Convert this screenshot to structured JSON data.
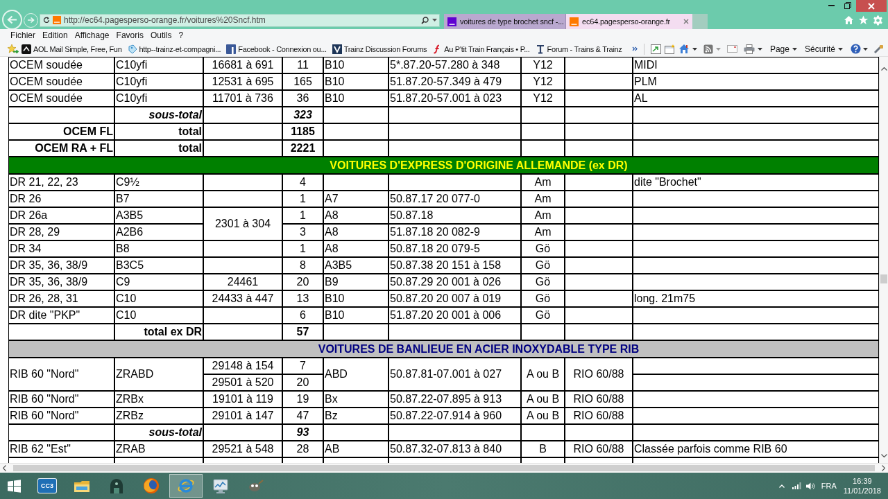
{
  "browser": {
    "address": "http://ec64.pagesperso-orange.fr/voitures%20Sncf.htm",
    "tabs": [
      {
        "title": "voitures de type brochet sncf -...",
        "color": "#5f01d1",
        "selected": false
      },
      {
        "title": "ec64.pagesperso-orange.fr",
        "color": "#ff7900",
        "selected": true
      }
    ]
  },
  "menu_bar": [
    "Fichier",
    "Edition",
    "Affichage",
    "Favoris",
    "Outils",
    "?"
  ],
  "favorites_bar": [
    {
      "label": "AOL Mail Simple, Free, Fun",
      "kind": "dark_tile"
    },
    {
      "label": "http--trainz-et-compagni...",
      "kind": "tag"
    },
    {
      "label": "Facebook - Connexion ou...",
      "kind": "blue_tile"
    },
    {
      "label": "Trainz Discussion Forums",
      "kind": "navy_tile"
    },
    {
      "label": "Au P'tit Train Français • P...",
      "kind": "red_stroke"
    },
    {
      "label": "Forum - Trains & Trainz",
      "kind": "beam"
    }
  ],
  "command_bar": {
    "menus": [
      "Page",
      "Sécurité"
    ]
  },
  "table": {
    "rows": [
      {
        "kind": "data",
        "column_1": "OCEM soudée",
        "column_2": "C10yfi",
        "column_3": "16681 à 691",
        "column_4": "11",
        "column_5": "B10",
        "column_6": "5*.87.20-57.280 à 348",
        "column_7": "Y12",
        "column_9": "MIDI"
      },
      {
        "kind": "data",
        "column_1": "OCEM soudée",
        "column_2": "C10yfi",
        "column_3": "12531 à 695",
        "column_4": "165",
        "column_5": "B10",
        "column_6": "51.87.20-57.349 à 479",
        "column_7": "Y12",
        "column_9": "PLM"
      },
      {
        "kind": "data",
        "column_1": "OCEM soudée",
        "column_2": "C10yfi",
        "column_3": "11701 à 736",
        "column_4": "36",
        "column_5": "B10",
        "column_6": "51.87.20-57.001 à 023",
        "column_7": "Y12",
        "column_9": "AL"
      },
      {
        "kind": "subtotal",
        "column_2": "sous-total",
        "column_4": "323"
      },
      {
        "kind": "total",
        "column_1": "OCEM FL",
        "column_2": "total",
        "column_4": "1185"
      },
      {
        "kind": "total",
        "column_1": "OCEM RA + FL",
        "column_2": "total",
        "column_4": "2221"
      },
      {
        "kind": "section",
        "color": "#008000",
        "title": {
          "text": "VOITURES D'EXPRESS D'ORIGINE ALLEMANDE (ex DR)",
          "color": "#ffff00"
        }
      },
      {
        "kind": "data",
        "column_1": "DR 21, 22, 23",
        "column_2": "C9½",
        "column_4": "4",
        "column_7": "Am",
        "column_9": "dite \"Brochet\""
      },
      {
        "kind": "data",
        "column_1": "DR 26",
        "column_2": "B7",
        "column_4": "1",
        "column_5": "A7",
        "column_6": "50.87.17 20 077-0",
        "column_7": "Am"
      },
      {
        "kind": "data",
        "column_3": "2301 à 304",
        "lines": [
          {
            "column_1": "DR 26a",
            "column_2": "A3B5",
            "column_4": "1",
            "column_5": "A8",
            "column_6": "50.87.18",
            "column_7": "Am"
          },
          {
            "column_1": "DR 28, 29",
            "column_2": "A2B6",
            "column_4": "3",
            "column_5": "A8",
            "column_6": "51.87.18 20 082-9",
            "column_7": "Am"
          }
        ]
      },
      {
        "kind": "data",
        "column_1": "DR 34",
        "column_2": "B8",
        "column_4": "1",
        "column_5": "A8",
        "column_6": "50.87.18 20 079-5",
        "column_7": "Gö"
      },
      {
        "kind": "data",
        "column_1": "DR 35, 36, 38/9",
        "column_2": "B3C5",
        "column_4": "8",
        "column_5": "A3B5",
        "column_6": "50.87.38 20 151 à 158",
        "column_7": "Gö"
      },
      {
        "kind": "data",
        "column_1": "DR 35, 36, 38/9",
        "column_2": "C9",
        "column_3": "24461",
        "column_4": "20",
        "column_5": "B9",
        "column_6": "50.87.29 20 001 à 026",
        "column_7": "Gö"
      },
      {
        "kind": "data",
        "column_1": "DR 26, 28, 31",
        "column_2": "C10",
        "column_3": "24433 à 447",
        "column_4": "13",
        "column_5": "B10",
        "column_6": "50.87.20 20 007 à 019",
        "column_7": "Gö",
        "column_9": "long. 21m75"
      },
      {
        "kind": "data",
        "column_1": "DR dite \"PKP\"",
        "column_2": "C10",
        "column_4": "6",
        "column_5": "B10",
        "column_6": "51.87.20 20 001 à 006",
        "column_7": "Gö"
      },
      {
        "kind": "total",
        "column_2": "total ex DR",
        "column_4": "57"
      },
      {
        "kind": "section",
        "color": "#c0c0c0",
        "title": {
          "text": "VOITURES DE BANLIEUE EN ACIER INOXYDABLE TYPE RIB",
          "color": "#000080"
        }
      },
      {
        "kind": "data",
        "column_1": "RIB 60 \"Nord\"",
        "column_2": "ZRABD",
        "column_5": "ABD",
        "column_6": "50.87.81-07.001 à 027",
        "column_7": "A ou B",
        "column_8": "RIO 60/88",
        "lines": [
          {
            "column_3": "29148 à 154",
            "column_4": "7"
          },
          {
            "column_3": "29501 à 520",
            "column_4": "20"
          }
        ]
      },
      {
        "kind": "data",
        "column_1": "RIB 60 \"Nord\"",
        "column_2": "ZRBx",
        "column_3": "19101 à 119",
        "column_4": "19",
        "column_5": "Bx",
        "column_6": "50.87.22-07.895 à 913",
        "column_7": "A ou B",
        "column_8": "RIO 60/88"
      },
      {
        "kind": "data",
        "column_1": "RIB 60 \"Nord\"",
        "column_2": "ZRBz",
        "column_3": "29101 à 147",
        "column_4": "47",
        "column_5": "Bz",
        "column_6": "50.87.22-07.914 à 960",
        "column_7": "A ou B",
        "column_8": "RIO 60/88"
      },
      {
        "kind": "subtotal",
        "column_2": "sous-total",
        "column_4": "93"
      },
      {
        "kind": "data",
        "column_1": "RIB 62 \"Est\"",
        "column_2": "ZRAB",
        "column_3": "29521 à 548",
        "column_4": "28",
        "column_5": "AB",
        "column_6": "50.87.32-07.813 à 840",
        "column_7": "B",
        "column_8": "RIO 60/88",
        "column_9": "Classée parfois comme RIB 60"
      }
    ]
  },
  "taskbar": {
    "apps": [
      {
        "kind": "tile",
        "label": "CC3",
        "selected": false
      },
      {
        "kind": "folder",
        "selected": false
      },
      {
        "kind": "dome",
        "selected": false
      },
      {
        "kind": "globe",
        "selected": false
      },
      {
        "kind": "ring",
        "selected": true
      },
      {
        "kind": "monitor",
        "selected": false
      },
      {
        "kind": "mascot",
        "selected": false
      }
    ],
    "language": "FRA",
    "time": "16:39",
    "date": "11/01/2018"
  }
}
